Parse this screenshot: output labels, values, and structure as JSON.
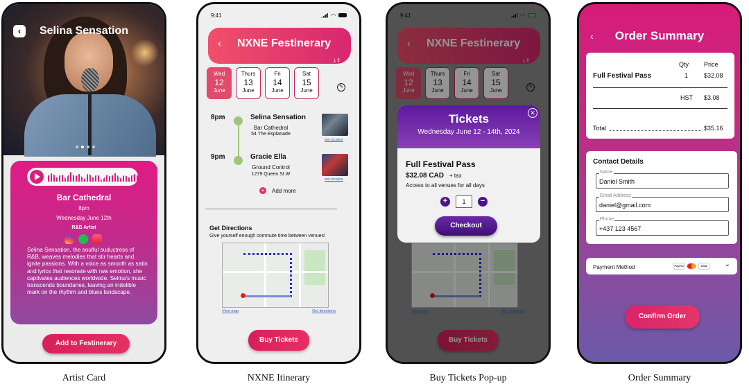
{
  "captions": [
    "Artist Card",
    "NXNE Itinerary",
    "Buy Tickets Pop-up",
    "Order Summary"
  ],
  "status_time": "9:41",
  "artist_card": {
    "title": "Selina Sensation",
    "venue": "Bar Cathedral",
    "time": "8pm",
    "date": "Wednesday June 12th",
    "genre": "R&B Artist",
    "bio": "Selina Sensation, the soulful suductress of R&B, weaves melodies that stir hearts and ignite passions. With a voice as smooth as satin and lyrics that resonate with raw emotion, she captivates audiences worldwide. Selina's music transcends boundaries, leaving an indelible mark on the rhythm and blues landscape.",
    "add_button": "Add to Festinerary",
    "social_icons": [
      "instagram-icon",
      "spotify-icon",
      "apple-music-icon"
    ]
  },
  "itinerary": {
    "title": "NXNE Festinerary",
    "days": [
      {
        "name": "Wed",
        "num": "12",
        "month": "June",
        "selected": true
      },
      {
        "name": "Thurs",
        "num": "13",
        "month": "June",
        "selected": false
      },
      {
        "name": "Fri",
        "num": "14",
        "month": "June",
        "selected": false
      },
      {
        "name": "Sat",
        "num": "15",
        "month": "June",
        "selected": false
      }
    ],
    "events": [
      {
        "time": "8pm",
        "name": "Selina Sensation",
        "venue": "Bar Cathedral",
        "address": "54 The Esplanade",
        "link": "see location"
      },
      {
        "time": "9pm",
        "name": "Gracie Ella",
        "venue": "Ground Control",
        "address": "1279 Queen St W",
        "link": "see location"
      }
    ],
    "add_more": "Add more",
    "directions_title": "Get Directions",
    "directions_sub": "Give yourself enough commute time between venues!",
    "view_map": "View map",
    "get_directions": "Get directions",
    "buy_button": "Buy Tickets"
  },
  "tickets_popup": {
    "title": "Tickets",
    "dates": "Wednesday June 12 - 14th, 2024",
    "pass_name": "Full Festival Pass",
    "price": "$32.08 CAD",
    "tax": "+ tax",
    "desc": "Access to all venues for all days",
    "quantity": "1",
    "checkout": "Checkout"
  },
  "order_summary": {
    "title": "Order Summary",
    "qty_label": "Qty",
    "price_label": "Price",
    "item": "Full Festival Pass",
    "item_qty": "1",
    "item_price": "$32.08",
    "hst_label": "HST",
    "hst_value": "$3.08",
    "total_label": "Total",
    "total_value": "$35.16",
    "contact_title": "Contact Details",
    "fields": [
      {
        "label": "Name",
        "value": "Daniel Smith"
      },
      {
        "label": "Email Address",
        "value": "daniel@gmail.com"
      },
      {
        "label": "Phone",
        "value": "+437 123 4567"
      }
    ],
    "payment_label": "Payment Method",
    "payment_logos": [
      "PayPal",
      "",
      "VISA"
    ],
    "confirm": "Confirm Order"
  }
}
